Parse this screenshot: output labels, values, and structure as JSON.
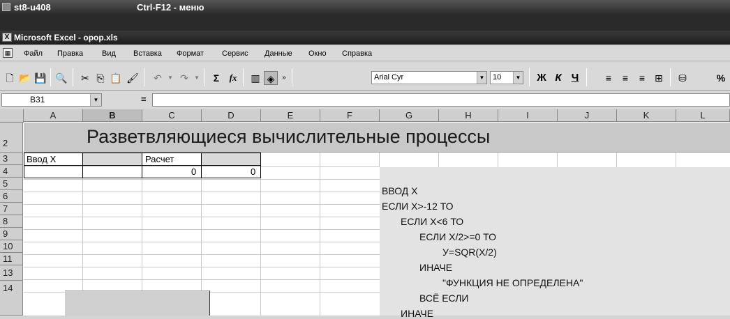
{
  "outer_window": {
    "title": "st8-u408",
    "hint": "Ctrl-F12 - меню"
  },
  "excel_window": {
    "title": "Microsoft Excel - opop.xls"
  },
  "menu": [
    "Файл",
    "Правка",
    "Вид",
    "Вставка",
    "Формат",
    "Сервис",
    "Данные",
    "Окно",
    "Справка"
  ],
  "toolbar": {
    "font_name": "Arial Cyr",
    "font_size": "10",
    "bold": "Ж",
    "italic": "К",
    "underline": "Ч",
    "sum": "Σ",
    "fx": "fx",
    "percent": "%"
  },
  "formula_bar": {
    "name_box": "B31",
    "equals": "=",
    "formula": ""
  },
  "columns": [
    "A",
    "B",
    "C",
    "D",
    "E",
    "F",
    "G",
    "H",
    "I",
    "J",
    "K",
    "L"
  ],
  "rows": [
    "2",
    "3",
    "4",
    "5",
    "6",
    "7",
    "8",
    "9",
    "10",
    "11",
    "13",
    "14"
  ],
  "cells": {
    "banner": "Разветвляющиеся вычислительные процессы",
    "a3": "Ввод X",
    "c3": "Расчет",
    "c4": "0",
    "d4": "0"
  },
  "algorithm": [
    "ВВОД X",
    "ЕСЛИ X>-12 ТО",
    "ЕСЛИ X<6 ТО",
    "ЕСЛИ X/2>=0 ТО",
    "У=SQR(X/2)",
    "ИНАЧЕ",
    "\"ФУНКЦИЯ НЕ ОПРЕДЕЛЕНА\"",
    "ВСЁ ЕСЛИ",
    "ИНАЧЕ"
  ]
}
